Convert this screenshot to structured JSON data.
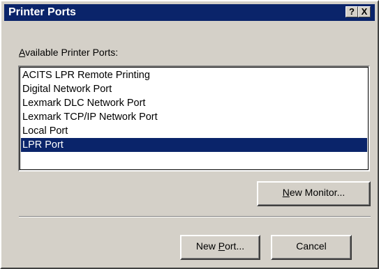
{
  "window": {
    "title": "Printer Ports",
    "help_button": "?",
    "close_button": "X"
  },
  "ports_label": {
    "accel": "A",
    "rest": "vailable Printer Ports:"
  },
  "ports": [
    "ACITS LPR Remote Printing",
    "Digital Network Port",
    "Lexmark DLC Network Port",
    "Lexmark TCP/IP Network Port",
    "Local Port",
    "LPR Port"
  ],
  "selected_port": "LPR Port",
  "buttons": {
    "new_monitor": {
      "accel": "N",
      "rest": "ew Monitor..."
    },
    "new_port": {
      "pre": "New ",
      "accel": "P",
      "rest": "ort..."
    },
    "cancel": "Cancel"
  },
  "colors": {
    "title_bar": "#0a246a",
    "selection": "#0a246a",
    "face": "#d4d0c8"
  }
}
